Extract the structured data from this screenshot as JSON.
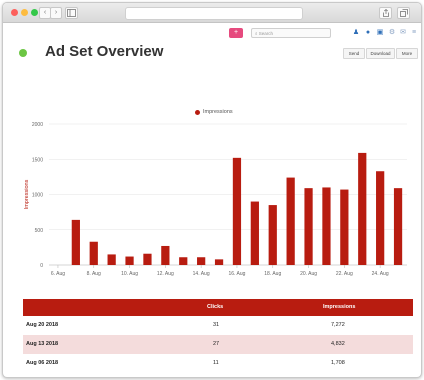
{
  "browser": {
    "nav_back": "‹",
    "nav_forward": "›",
    "sidebar_icon": "sidebar-icon",
    "share_icon": "share-icon",
    "tabs_icon": "tabs-icon"
  },
  "appbar": {
    "add_button": "+",
    "search_placeholder": "Search",
    "icons": [
      "user-icon",
      "globe-icon",
      "notebook-icon",
      "settings-icon",
      "mail-icon",
      "menu-icon"
    ]
  },
  "header": {
    "title": "Ad Set Overview",
    "status_color": "#6cc644",
    "buttons": [
      "Send",
      "Download",
      "More"
    ]
  },
  "chart_data": {
    "type": "bar",
    "title": "",
    "xlabel": "",
    "ylabel": "Impressions",
    "ylim": [
      0,
      2000
    ],
    "yticks": [
      0,
      500,
      1000,
      1500,
      2000
    ],
    "xtick_labels": [
      "6. Aug",
      "8. Aug",
      "10. Aug",
      "12. Aug",
      "14. Aug",
      "16. Aug",
      "18. Aug",
      "20. Aug",
      "22. Aug",
      "24. Aug"
    ],
    "legend": "top-center",
    "grid": true,
    "color": "#b81c10",
    "series": [
      {
        "name": "Impressions",
        "values": [
          0,
          640,
          330,
          150,
          120,
          160,
          270,
          110,
          110,
          80,
          1520,
          900,
          850,
          1240,
          1090,
          1100,
          1070,
          1590,
          1330,
          1090
        ]
      }
    ]
  },
  "table": {
    "columns": [
      "",
      "Clicks",
      "Impressions"
    ],
    "rows": [
      [
        "Aug 20 2018",
        "31",
        "7,272"
      ],
      [
        "Aug 13 2018",
        "27",
        "4,832"
      ],
      [
        "Aug 06 2018",
        "11",
        "1,708"
      ]
    ],
    "header_color": "#b81c10",
    "alt_row_color": "#f4dcdc"
  }
}
